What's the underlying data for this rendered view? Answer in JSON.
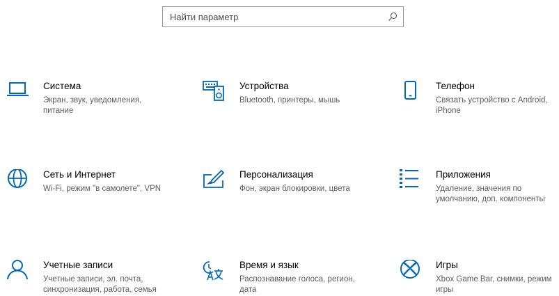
{
  "search": {
    "placeholder": "Найти параметр",
    "icon": "search-icon"
  },
  "accent_color": "#0067c0",
  "tiles": [
    {
      "id": "system",
      "title": "Система",
      "desc": "Экран, звук, уведомления, питание",
      "icon": "laptop-icon"
    },
    {
      "id": "devices",
      "title": "Устройства",
      "desc": "Bluetooth, принтеры, мышь",
      "icon": "devices-icon"
    },
    {
      "id": "phone",
      "title": "Телефон",
      "desc": "Связать устройство с Android, iPhone",
      "icon": "phone-icon"
    },
    {
      "id": "network",
      "title": "Сеть и Интернет",
      "desc": "Wi-Fi, режим \"в самолете\", VPN",
      "icon": "globe-icon"
    },
    {
      "id": "personalization",
      "title": "Персонализация",
      "desc": "Фон, экран блокировки, цвета",
      "icon": "paint-icon"
    },
    {
      "id": "apps",
      "title": "Приложения",
      "desc": "Удаление, значения по умолчанию, доп. компоненты",
      "icon": "apps-list-icon"
    },
    {
      "id": "accounts",
      "title": "Учетные записи",
      "desc": "Учетные записи, эл. почта, синхронизация, работа, семья",
      "icon": "person-icon"
    },
    {
      "id": "time",
      "title": "Время и язык",
      "desc": "Распознавание голоса, регион, дата",
      "icon": "time-language-icon"
    },
    {
      "id": "gaming",
      "title": "Игры",
      "desc": "Xbox Game Bar, снимки, режим игры",
      "icon": "xbox-icon"
    }
  ]
}
